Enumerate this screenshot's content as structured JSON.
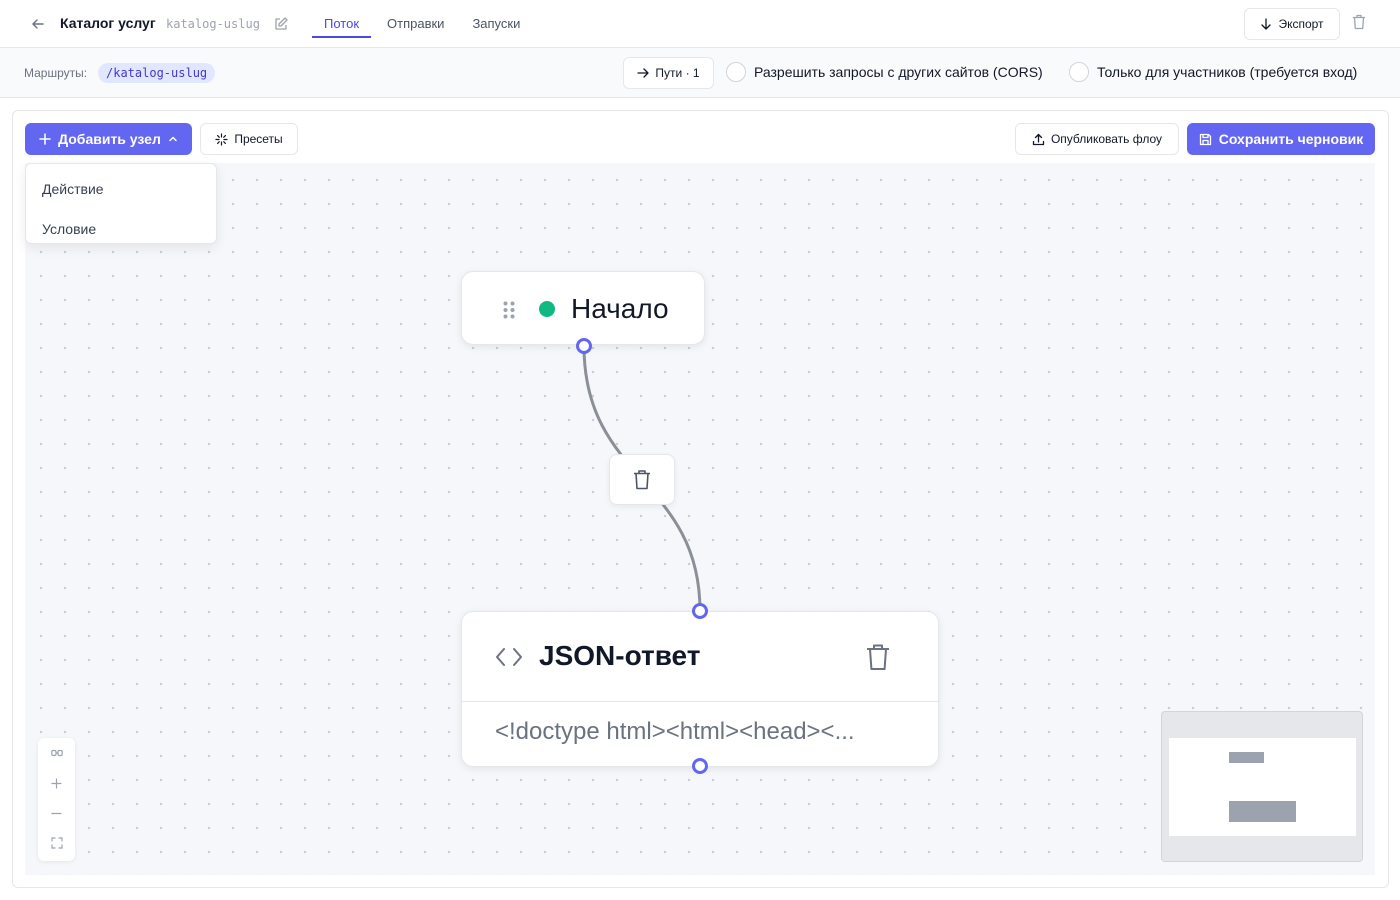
{
  "header": {
    "title": "Каталог услуг",
    "slug": "katalog-uslug",
    "tabs": [
      {
        "label": "Поток",
        "active": true
      },
      {
        "label": "Отправки",
        "active": false
      },
      {
        "label": "Запуски",
        "active": false
      }
    ],
    "export_label": "Экспорт"
  },
  "routes": {
    "label": "Маршруты:",
    "chip": "/katalog-uslug",
    "paths_label": "Пути · 1",
    "cors_label": "Разрешить запросы с других сайтов (CORS)",
    "members_label": "Только для участников (требуется вход)"
  },
  "toolbar": {
    "add_node_label": "Добавить узел",
    "presets_label": "Пресеты",
    "publish_label": "Опубликовать флоу",
    "save_label": "Сохранить черновик"
  },
  "dropdown": {
    "items": [
      "Действие",
      "Условие"
    ]
  },
  "nodes": {
    "start": {
      "label": "Начало",
      "status_color": "#10b981"
    },
    "json": {
      "title": "JSON-ответ",
      "preview": "<!doctype html><html><head><..."
    }
  },
  "colors": {
    "accent": "#6366f1",
    "status_active": "#10b981",
    "canvas_bg": "#f5f7fa"
  },
  "icons": [
    "arrow-left-icon",
    "pencil-icon",
    "arrow-down-icon",
    "trash-icon",
    "arrow-right-icon",
    "plus-icon",
    "chevron-up-icon",
    "sparkle-icon",
    "upload-icon",
    "save-icon",
    "drag-handle-icon",
    "code-icon",
    "link-icon",
    "minus-icon",
    "fit-view-icon"
  ]
}
